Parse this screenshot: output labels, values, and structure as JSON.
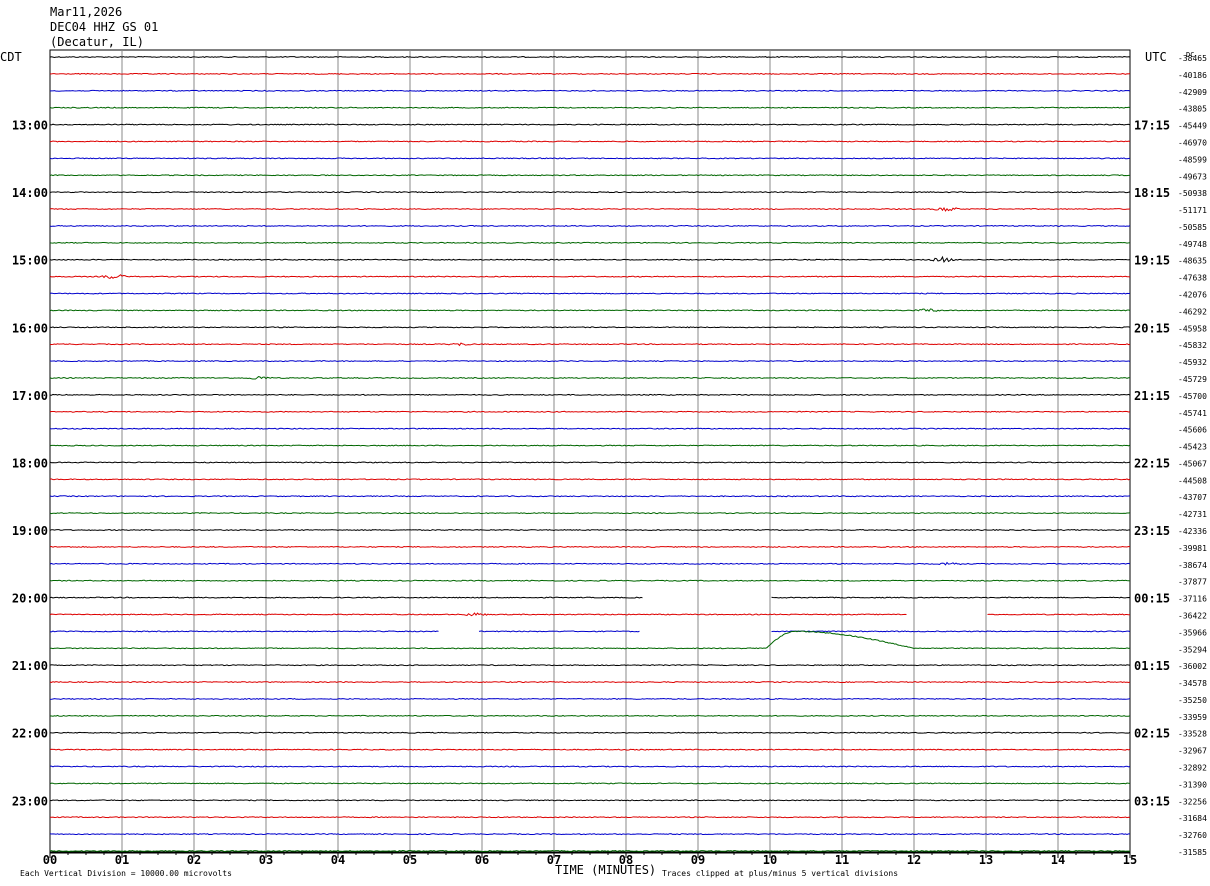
{
  "header": {
    "date": "Mar11,2026",
    "station": "DEC04 HHZ GS 01",
    "location": "(Decatur, IL)"
  },
  "left_tz": "CDT",
  "right_tz": "UTC",
  "dc_label": "DC",
  "footer": {
    "scale_note": "Each Vertical Division = 10000.00 microvolts",
    "xlabel": "TIME (MINUTES)",
    "clip_note": "Traces clipped at plus/minus 5 vertical divisions"
  },
  "colors": {
    "trace_cycle": [
      "#000000",
      "#dd0000",
      "#0000cc",
      "#006600"
    ],
    "grid": "#888888"
  },
  "chart_data": {
    "type": "line",
    "subtype": "helicorder",
    "x_ticks": [
      "00",
      "01",
      "02",
      "03",
      "04",
      "05",
      "06",
      "07",
      "08",
      "09",
      "10",
      "11",
      "12",
      "13",
      "14",
      "15"
    ],
    "xlim": [
      0,
      15
    ],
    "left_hour_labels": [
      "13:00",
      "14:00",
      "15:00",
      "16:00",
      "17:00",
      "18:00",
      "19:00",
      "20:00",
      "21:00",
      "22:00",
      "23:00"
    ],
    "right_hour_labels": [
      "17:15",
      "18:15",
      "19:15",
      "20:15",
      "21:15",
      "22:15",
      "23:15",
      "00:15",
      "01:15",
      "02:15",
      "03:15"
    ],
    "first_hour_label_row": 4,
    "row_count": 48,
    "dc_offsets": [
      "-38465",
      "-40186",
      "-42909",
      "-43805",
      "-45449",
      "-46970",
      "-48599",
      "-49673",
      "-50938",
      "-51171",
      "-50585",
      "-49748",
      "-48635",
      "-47638",
      "-42076",
      "-46292",
      "-45958",
      "-45832",
      "-45932",
      "-45729",
      "-45700",
      "-45741",
      "-45606",
      "-45423",
      "-45067",
      "-44508",
      "-43707",
      "-42731",
      "-42336",
      "-39981",
      "-38674",
      "-37877",
      "-37116",
      "-36422",
      "-35966",
      "-35294",
      "-36002",
      "-34578",
      "-35250",
      "-33959",
      "-33528",
      "-32967",
      "-32892",
      "-31390",
      "-32256",
      "-31684",
      "-32760",
      "-31585"
    ],
    "events": [
      {
        "row": 9,
        "minute": 12.45,
        "amplitude": 3
      },
      {
        "row": 12,
        "minute": 12.4,
        "amplitude": 3
      },
      {
        "row": 13,
        "minute": 0.9,
        "amplitude": 3
      },
      {
        "row": 15,
        "minute": 12.2,
        "amplitude": 2
      },
      {
        "row": 17,
        "minute": 5.7,
        "amplitude": 1.5
      },
      {
        "row": 19,
        "minute": 2.9,
        "amplitude": 2
      },
      {
        "row": 30,
        "minute": 12.5,
        "amplitude": 2
      },
      {
        "row": 33,
        "minute": 5.9,
        "amplitude": 2
      }
    ],
    "gaps": [
      {
        "row": 32,
        "start": 8.25,
        "end": 10.0
      },
      {
        "row": 33,
        "start": 11.9,
        "end": 13.0
      },
      {
        "row": 34,
        "start": 5.4,
        "end": 5.95
      },
      {
        "row": 34,
        "start": 8.2,
        "end": 10.0
      }
    ],
    "excursions": [
      {
        "row": 35,
        "start": 9.95,
        "peak_minute": 10.35,
        "end": 12.0,
        "amplitude": 1.0
      }
    ]
  }
}
